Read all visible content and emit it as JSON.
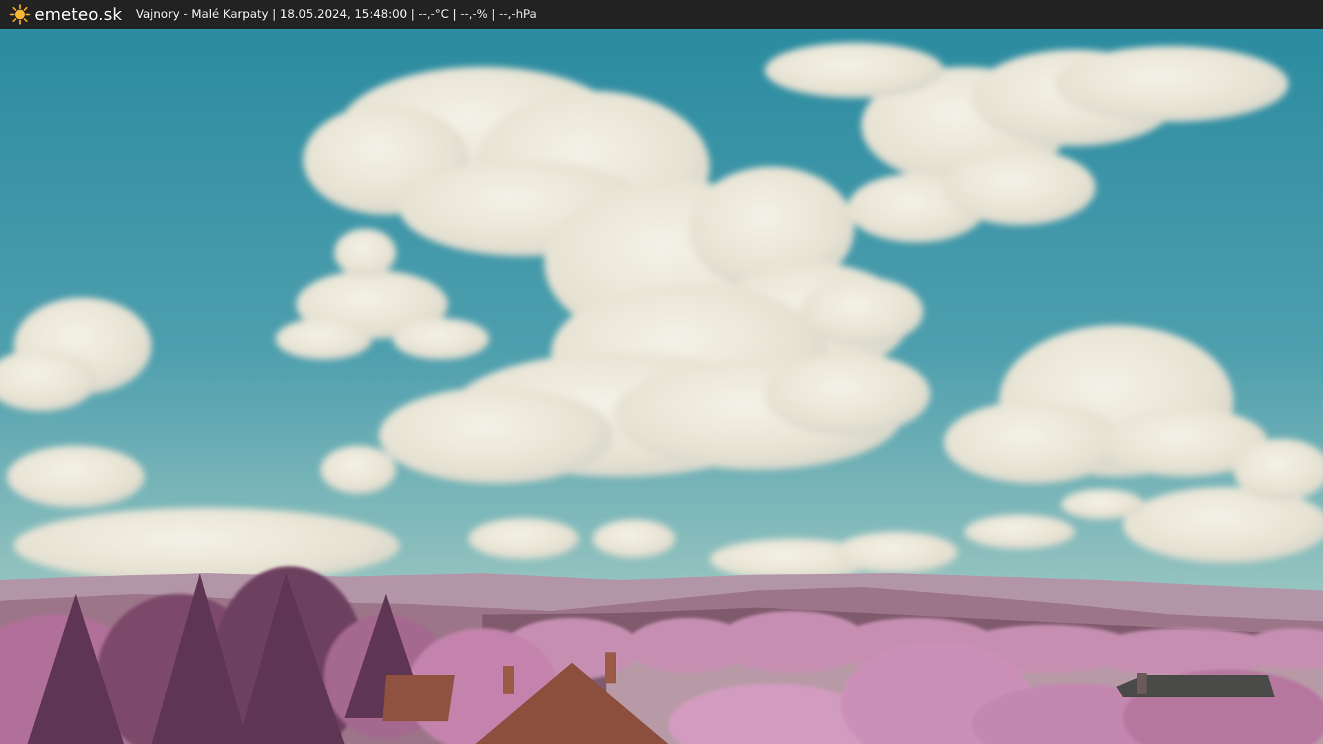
{
  "header": {
    "brand": "emeteo.sk",
    "logo_icon": "sun-icon",
    "caption": "Vajnory - Malé Karpaty | 18.05.2024, 15:48:00 | --,-°C | --,-% | --,-hPa"
  },
  "colors": {
    "bar_background": "#222222",
    "sun": "#f5a623",
    "sky_top": "#2f8fa3",
    "sky_bottom": "#9cc6c4",
    "cloud": "#ece8da",
    "foliage": "#b87aa4",
    "roof": "#8c4f3d"
  }
}
